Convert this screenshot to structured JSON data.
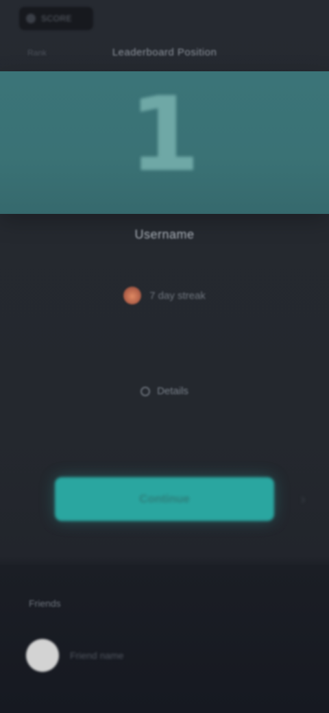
{
  "header": {
    "logo_text": "SCORE",
    "prefix": "Rank",
    "title": "Leaderboard Position"
  },
  "hero": {
    "rank": "1"
  },
  "player": {
    "name": "Username",
    "streak_text": "7 day streak",
    "details_text": "Details"
  },
  "actions": {
    "primary_label": "Continue",
    "chevron": "›"
  },
  "friends": {
    "section_label": "Friends",
    "items": [
      {
        "name": "Friend name"
      }
    ]
  },
  "colors": {
    "accent": "#2aa6a0",
    "hero_bg": "#3b7478",
    "flame": "#e08a63",
    "background": "#24272e"
  },
  "icons": {
    "logo": "app-logo-icon",
    "streak": "flame-icon",
    "details": "info-icon",
    "chevron": "chevron-right-icon"
  }
}
